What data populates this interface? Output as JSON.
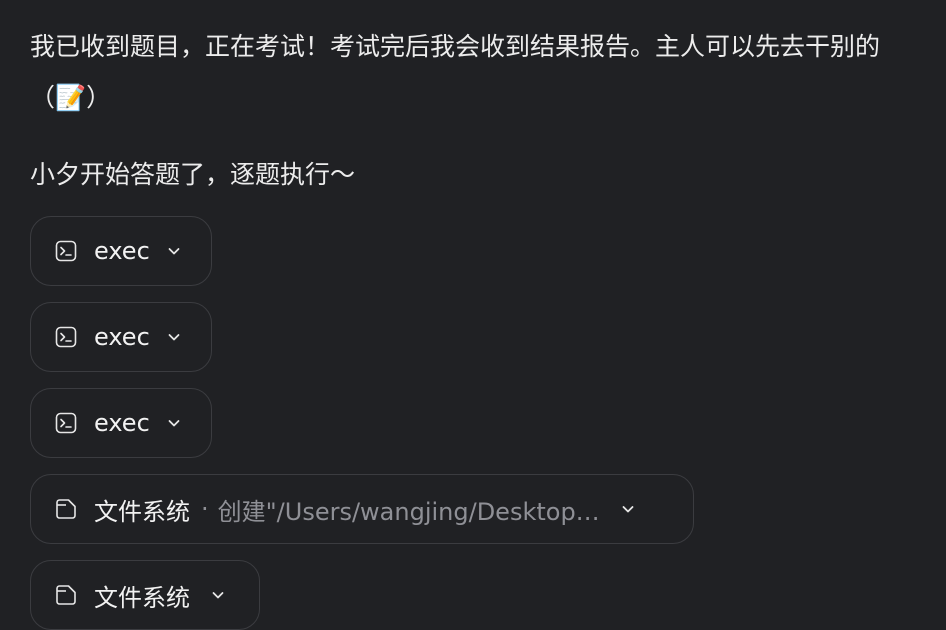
{
  "messages": {
    "intro": "我已收到题目，正在考试！考试完后我会收到结果报告。主人可以先去干别的（📝）",
    "start": "小夕开始答题了，逐题执行～"
  },
  "tool_calls": [
    {
      "icon": "terminal-icon",
      "label": "exec",
      "detail": ""
    },
    {
      "icon": "terminal-icon",
      "label": "exec",
      "detail": ""
    },
    {
      "icon": "terminal-icon",
      "label": "exec",
      "detail": ""
    },
    {
      "icon": "file-icon",
      "label": "文件系统",
      "separator": "·",
      "detail": "创建\"/Users/wangjing/Desktop…"
    },
    {
      "icon": "file-icon",
      "label": "文件系统",
      "detail": ""
    }
  ],
  "colors": {
    "background": "#202124",
    "text": "#ececec",
    "muted": "#8f9096",
    "chip_border": "#3b3c40"
  }
}
